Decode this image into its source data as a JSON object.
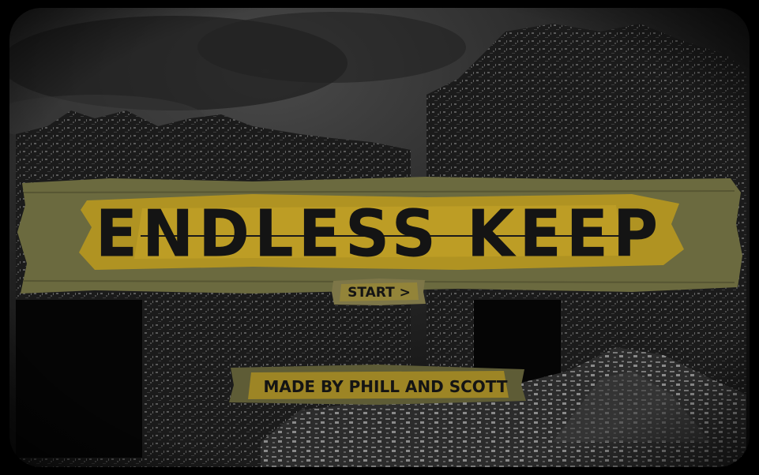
{
  "title": "ENDLESS KEEP",
  "start_button": {
    "label": "START >"
  },
  "credits": {
    "label": "MADE BY PHILL AND SCOTT"
  },
  "colors": {
    "plank_base": "#6b6a3f",
    "plank_highlight": "#b8981f",
    "text": "#141414",
    "background": "#000000"
  }
}
